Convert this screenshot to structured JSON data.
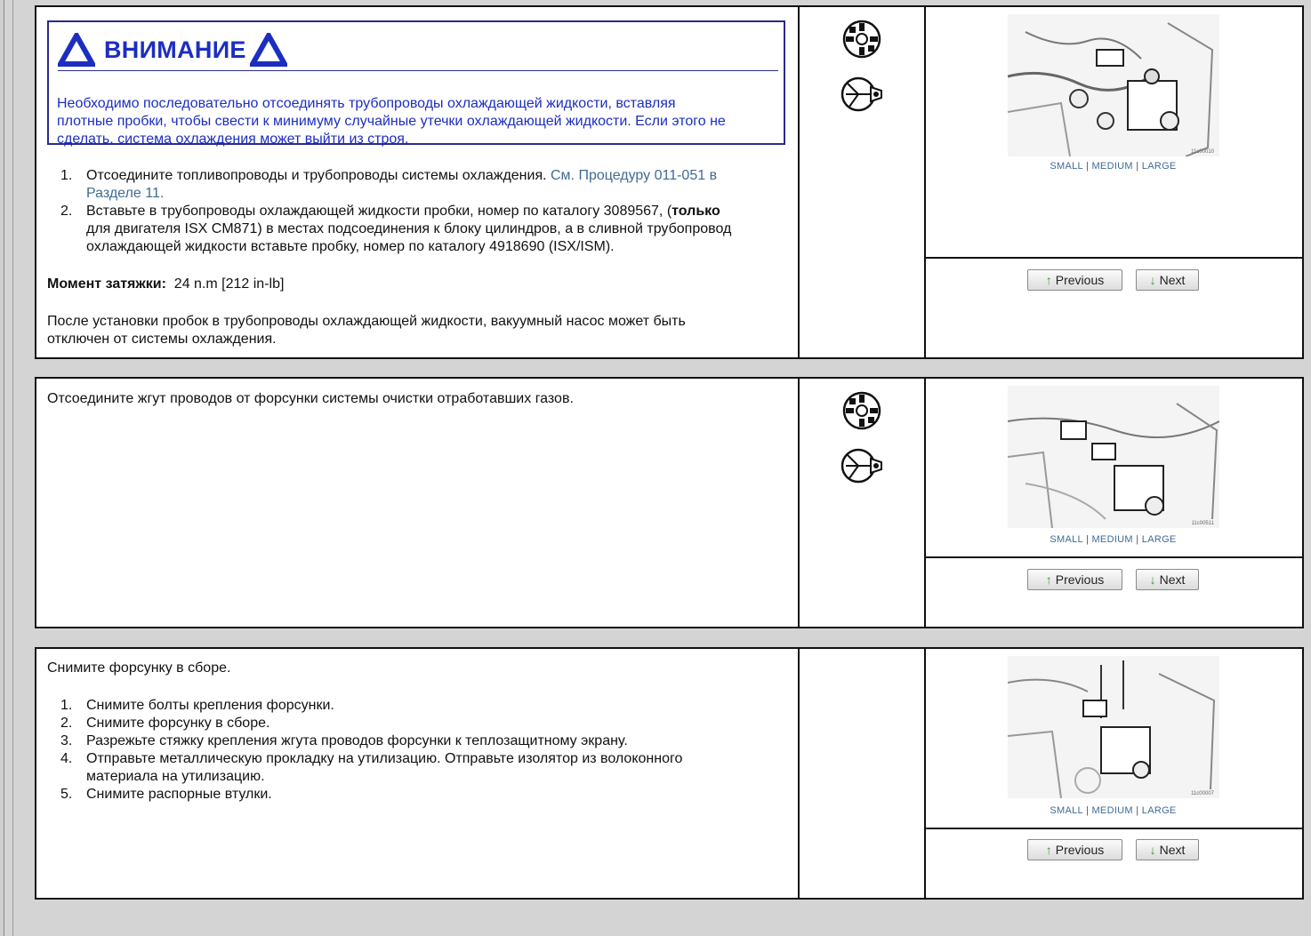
{
  "colors": {
    "warning_blue": "#1c2ec0",
    "link_blue": "#3f6b94",
    "size_links": "#4a7aa6",
    "nav_arrow": "#3a9a3a"
  },
  "icons": {
    "tools": "gear-tool-icon",
    "wrench": "wrench-tool-icon",
    "warning": "warning-triangle-icon"
  },
  "common": {
    "small": "SMALL",
    "medium": "MEDIUM",
    "large": "LARGE",
    "sep": "|",
    "previous": "Previous",
    "next": "Next"
  },
  "panel1": {
    "warning": {
      "title": "ВНИМАНИЕ",
      "body_line1": "Необходимо последовательно отсоединять трубопроводы охлаждающей жидкости, вставляя",
      "body_line2": "плотные пробки, чтобы свести к минимуму случайные утечки охлаждающей жидкости. Если этого не",
      "body_line3": "сделать, система охлаждения может выйти из строя."
    },
    "step1": {
      "num": "1.",
      "text": "Отсоедините топливопроводы и трубопроводы системы охлаждения. ",
      "link_a": "См. Процедуру 011-051 в",
      "link_b": "Разделе 11."
    },
    "step2": {
      "num": "2.",
      "line1_a": "Вставьте в трубопроводы охлаждающей жидкости пробки, номер по каталогу 3089567, (",
      "line1_bold": "только",
      "line2": "для двигателя ISX CM871) в местах подсоединения к блоку цилиндров, а в сливной трубопровод",
      "line3": "охлаждающей жидкости вставьте пробку, номер по каталогу 4918690 (ISX/ISM)."
    },
    "torque_label": "Момент затяжки:",
    "torque_value": "24  n.m  [212 in-lb]",
    "note_line1": "После установки пробок в трубопроводы охлаждающей жидкости, вакуумный насос может быть",
    "note_line2": "отключен от системы охлаждения.",
    "image_code": "11c00010"
  },
  "panel2": {
    "text": "Отсоедините жгут проводов от форсунки системы очистки отработавших газов.",
    "image_code": "11c00511"
  },
  "panel3": {
    "intro": "Снимите форсунку в сборе.",
    "steps": [
      {
        "num": "1.",
        "line1": "Снимите болты крепления форсунки."
      },
      {
        "num": "2.",
        "line1": "Снимите форсунку в сборе."
      },
      {
        "num": "3.",
        "line1": "Разрежьте стяжку крепления жгута проводов форсунки к теплозащитному экрану."
      },
      {
        "num": "4.",
        "line1": "Отправьте металлическую прокладку на утилизацию. Отправьте изолятор из волоконного",
        "line2": "материала на утилизацию."
      },
      {
        "num": "5.",
        "line1": "Снимите распорные втулки."
      }
    ],
    "image_code": "11c00007"
  }
}
